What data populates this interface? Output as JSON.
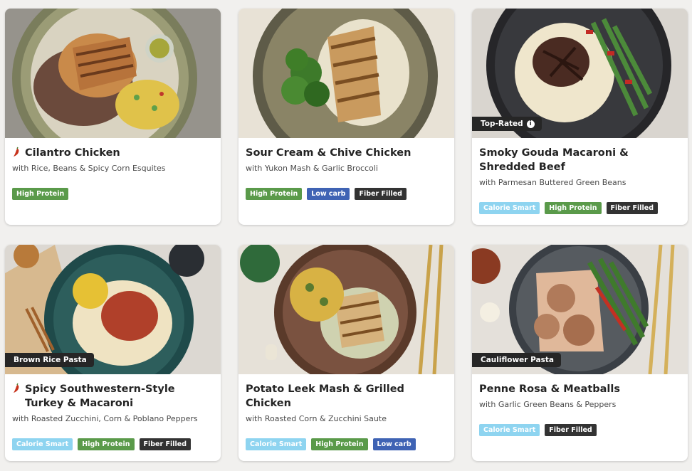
{
  "colors": {
    "high_protein": "#5a9a4a",
    "low_carb": "#3f63b4",
    "fiber_filled": "#333333",
    "calorie_smart": "#8ed4f0",
    "ribbon": "#262626",
    "spicy": "#c7321b"
  },
  "icons": {
    "spicy": "chili-pepper-icon",
    "info": "info-icon"
  },
  "cards": [
    {
      "title": "Cilantro Chicken",
      "subtitle": "with Rice, Beans & Spicy Corn Esquites",
      "spicy": true,
      "ribbon": "",
      "tags": [
        "High Protein"
      ]
    },
    {
      "title": "Sour Cream & Chive Chicken",
      "subtitle": "with Yukon Mash & Garlic Broccoli",
      "spicy": false,
      "ribbon": "",
      "tags": [
        "High Protein",
        "Low carb",
        "Fiber Filled"
      ]
    },
    {
      "title": "Smoky Gouda Macaroni & Shredded Beef",
      "subtitle": "with Parmesan Buttered Green Beans",
      "spicy": false,
      "ribbon": "Top-Rated",
      "ribbon_info": "i",
      "tags": [
        "Calorie Smart",
        "High Protein",
        "Fiber Filled"
      ]
    },
    {
      "title": "Spicy Southwestern-Style Turkey & Macaroni",
      "subtitle": "with Roasted Zucchini, Corn & Poblano Peppers",
      "spicy": true,
      "ribbon": "Brown Rice Pasta",
      "tags": [
        "Calorie Smart",
        "High Protein",
        "Fiber Filled"
      ]
    },
    {
      "title": "Potato Leek Mash & Grilled Chicken",
      "subtitle": "with Roasted Corn & Zucchini Saute",
      "spicy": false,
      "ribbon": "",
      "tags": [
        "Calorie Smart",
        "High Protein",
        "Low carb"
      ]
    },
    {
      "title": "Penne Rosa & Meatballs",
      "subtitle": "with Garlic Green Beans & Peppers",
      "spicy": false,
      "ribbon": "Cauliflower Pasta",
      "tags": [
        "Calorie Smart",
        "Fiber Filled"
      ]
    }
  ]
}
